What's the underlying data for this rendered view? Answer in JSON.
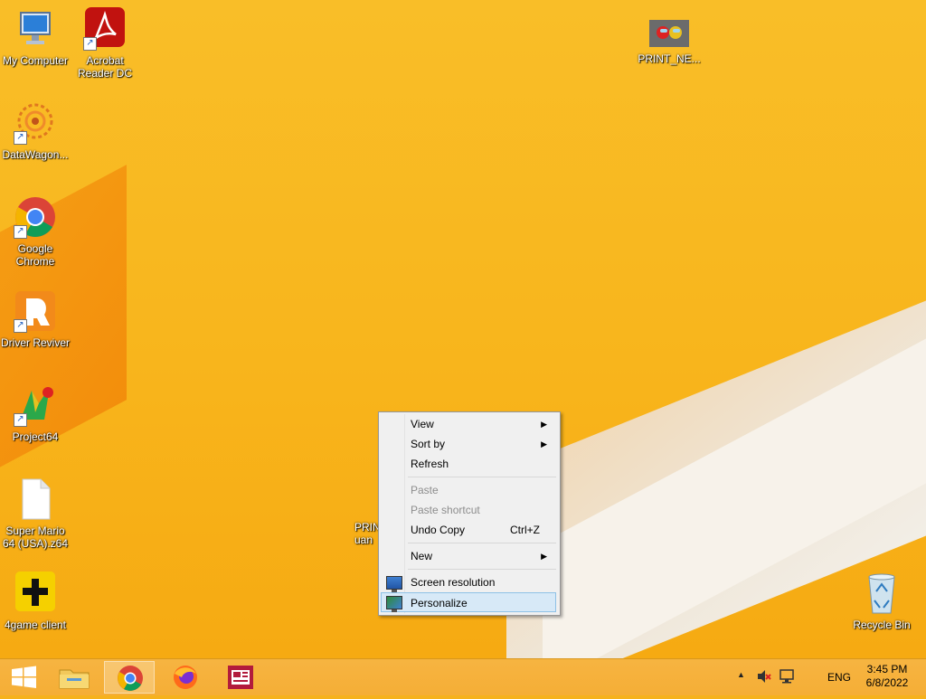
{
  "desktop": {
    "icons": [
      {
        "label": "My Computer"
      },
      {
        "label": "Acrobat Reader DC"
      },
      {
        "label": "PRINT_NE..."
      },
      {
        "label": "DataWagon..."
      },
      {
        "label": "Google Chrome"
      },
      {
        "label": "Driver Reviver"
      },
      {
        "label": "Project64"
      },
      {
        "label": "Super Mario 64 (USA).z64"
      },
      {
        "label": "4game client"
      },
      {
        "label": "PRIN _Am uan"
      },
      {
        "label": "Recycle Bin"
      }
    ]
  },
  "context_menu": {
    "items": [
      {
        "label": "View",
        "submenu": true
      },
      {
        "label": "Sort by",
        "submenu": true
      },
      {
        "label": "Refresh"
      },
      {
        "label": "Paste",
        "disabled": true
      },
      {
        "label": "Paste shortcut",
        "disabled": true
      },
      {
        "label": "Undo Copy",
        "shortcut": "Ctrl+Z"
      },
      {
        "label": "New",
        "submenu": true
      },
      {
        "label": "Screen resolution",
        "icon": "monitor-icon"
      },
      {
        "label": "Personalize",
        "icon": "monitor-paint-icon",
        "highlighted": true
      }
    ]
  },
  "taskbar": {
    "buttons": [
      "start-button",
      "file-explorer",
      "google-chrome",
      "firefox",
      "news-app"
    ],
    "tray": {
      "language": "ENG",
      "time": "3:45 PM",
      "date": "6/8/2022"
    }
  },
  "colors": {
    "desktop_bg": "#f8b51c",
    "taskbar_bg": "#f5ae36",
    "menu_highlight": "#d7e9f7"
  }
}
